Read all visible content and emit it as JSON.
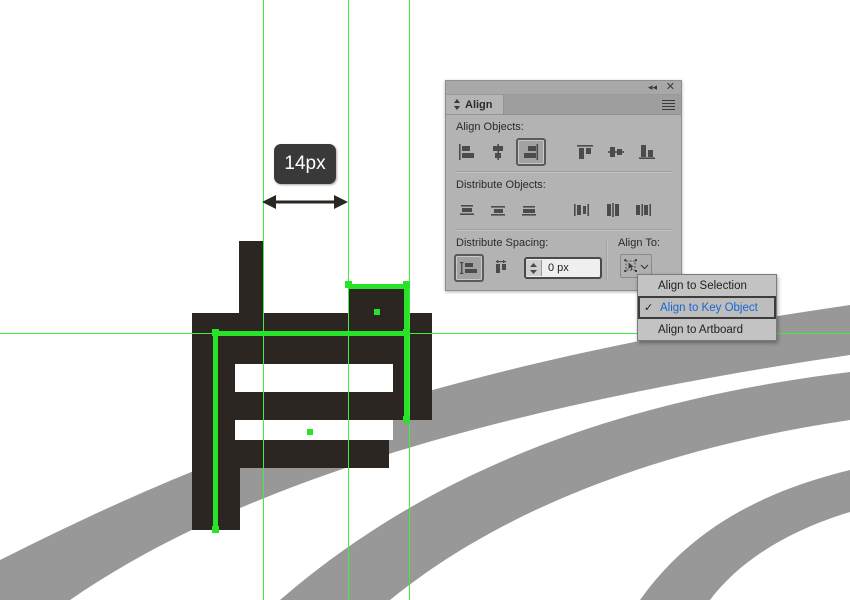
{
  "app": {
    "document_background": "#ffffff",
    "artwork_color": "#2b2622",
    "swoosh_color": "#989898",
    "guide_color": "#3ef03e",
    "selection_color": "#29e329"
  },
  "measurement": {
    "label": "14px",
    "badge_background": "#393939",
    "badge_text_color": "#ffffff",
    "arrow_icon": "double-headed-arrow-icon"
  },
  "align_panel": {
    "title": "Align",
    "tab_icon": "panel-grip-icon",
    "collapse_icon": "double-chevron-left-icon",
    "close_icon": "close-x-icon",
    "menu_icon": "panel-options-menu-icon",
    "sections": {
      "align_objects": {
        "label": "Align Objects:",
        "buttons": [
          {
            "name": "horizontal-align-left",
            "icon": "align-left-icon",
            "pressed": false
          },
          {
            "name": "horizontal-align-center",
            "icon": "align-center-icon",
            "pressed": false
          },
          {
            "name": "horizontal-align-right",
            "icon": "align-right-icon",
            "pressed": true
          },
          {
            "name": "vertical-align-top",
            "icon": "align-top-icon",
            "pressed": false
          },
          {
            "name": "vertical-align-center",
            "icon": "align-middle-icon",
            "pressed": false
          },
          {
            "name": "vertical-align-bottom",
            "icon": "align-bottom-icon",
            "pressed": false
          }
        ]
      },
      "distribute_objects": {
        "label": "Distribute Objects:",
        "buttons": [
          {
            "name": "vertical-distribute-top",
            "icon": "distribute-top-icon",
            "pressed": false
          },
          {
            "name": "vertical-distribute-center",
            "icon": "distribute-middle-icon",
            "pressed": false
          },
          {
            "name": "vertical-distribute-bottom",
            "icon": "distribute-bottom-icon",
            "pressed": false
          },
          {
            "name": "horizontal-distribute-left",
            "icon": "distribute-left-icon",
            "pressed": false
          },
          {
            "name": "horizontal-distribute-center",
            "icon": "distribute-center-icon",
            "pressed": false
          },
          {
            "name": "horizontal-distribute-right",
            "icon": "distribute-right-icon",
            "pressed": false
          }
        ]
      },
      "distribute_spacing": {
        "label": "Distribute Spacing:",
        "buttons": [
          {
            "name": "vertical-distribute-spacing",
            "icon": "vertical-spacing-icon",
            "pressed": true
          },
          {
            "name": "horizontal-distribute-spacing",
            "icon": "horizontal-spacing-icon",
            "pressed": false
          }
        ],
        "spacing_value": "0 px",
        "stepper_icon": "up-down-stepper-icon"
      },
      "align_to": {
        "label": "Align To:",
        "button_icon": "align-to-key-object-icon",
        "chevron_icon": "chevron-down-icon"
      }
    }
  },
  "align_menu": {
    "items": [
      {
        "label": "Align to Selection",
        "checked": false
      },
      {
        "label": "Align to Key Object",
        "checked": true
      },
      {
        "label": "Align to Artboard",
        "checked": false
      }
    ],
    "check_glyph": "✓",
    "highlight_text_color": "#1967d2"
  }
}
